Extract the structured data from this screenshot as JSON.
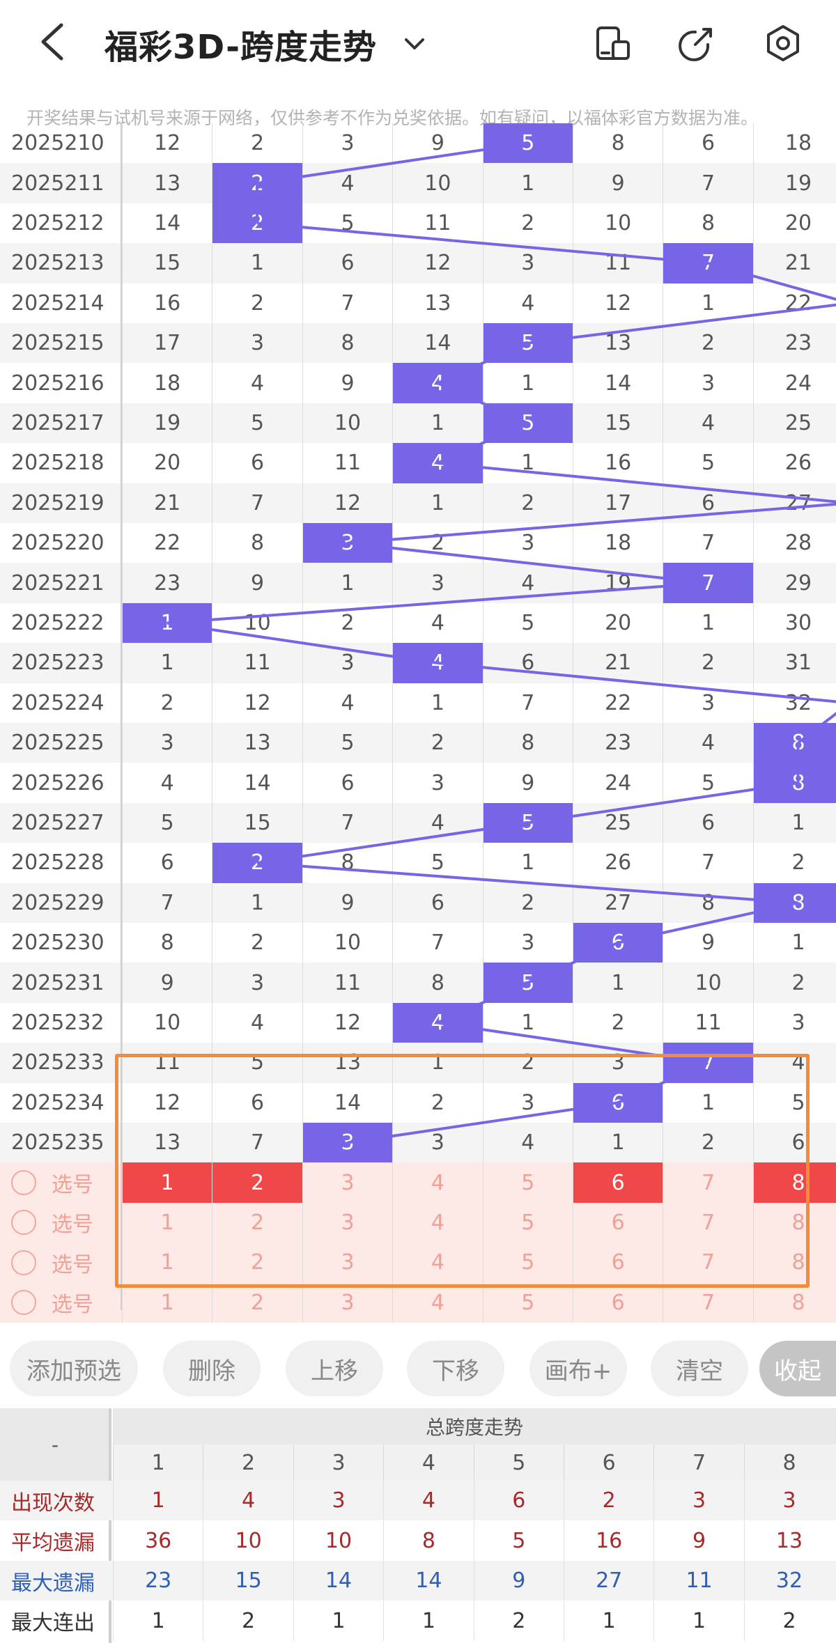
{
  "header": {
    "title": "福彩3D-跨度走势",
    "back_icon": "chevron-left-icon",
    "dropdown_icon": "chevron-down-icon",
    "icons": [
      "phone-layout-icon",
      "share-icon",
      "settings-icon"
    ]
  },
  "notice": "开奖结果与试机号来源于网络，仅供参考不作为兑奖依据。如有疑问，以福体彩官方数据为准。",
  "colors": {
    "hit": "#7665e6",
    "pick_selected": "#f04848",
    "pick_text": "#f0a097",
    "highlight_box": "#f28c3b",
    "stat_red": "#a52a2a",
    "stat_blue": "#2e5fb5"
  },
  "rows": [
    {
      "period": "2025210",
      "cells": [
        "12",
        "2",
        "3",
        "9",
        "5",
        "8",
        "6",
        "18"
      ],
      "hit": 4
    },
    {
      "period": "2025211",
      "cells": [
        "13",
        "2",
        "4",
        "10",
        "1",
        "9",
        "7",
        "19"
      ],
      "hit": 1
    },
    {
      "period": "2025212",
      "cells": [
        "14",
        "2",
        "5",
        "11",
        "2",
        "10",
        "8",
        "20"
      ],
      "hit": 1
    },
    {
      "period": "2025213",
      "cells": [
        "15",
        "1",
        "6",
        "12",
        "3",
        "11",
        "7",
        "21"
      ],
      "hit": 6
    },
    {
      "period": "2025214",
      "cells": [
        "16",
        "2",
        "7",
        "13",
        "4",
        "12",
        "1",
        "22"
      ],
      "hit": -1
    },
    {
      "period": "2025215",
      "cells": [
        "17",
        "3",
        "8",
        "14",
        "5",
        "13",
        "2",
        "23"
      ],
      "hit": 4
    },
    {
      "period": "2025216",
      "cells": [
        "18",
        "4",
        "9",
        "4",
        "1",
        "14",
        "3",
        "24"
      ],
      "hit": 3
    },
    {
      "period": "2025217",
      "cells": [
        "19",
        "5",
        "10",
        "1",
        "5",
        "15",
        "4",
        "25"
      ],
      "hit": 4
    },
    {
      "period": "2025218",
      "cells": [
        "20",
        "6",
        "11",
        "4",
        "1",
        "16",
        "5",
        "26"
      ],
      "hit": 3
    },
    {
      "period": "2025219",
      "cells": [
        "21",
        "7",
        "12",
        "1",
        "2",
        "17",
        "6",
        "27"
      ],
      "hit": -1
    },
    {
      "period": "2025220",
      "cells": [
        "22",
        "8",
        "3",
        "2",
        "3",
        "18",
        "7",
        "28"
      ],
      "hit": 2
    },
    {
      "period": "2025221",
      "cells": [
        "23",
        "9",
        "1",
        "3",
        "4",
        "19",
        "7",
        "29"
      ],
      "hit": 6
    },
    {
      "period": "2025222",
      "cells": [
        "1",
        "10",
        "2",
        "4",
        "5",
        "20",
        "1",
        "30"
      ],
      "hit": 0
    },
    {
      "period": "2025223",
      "cells": [
        "1",
        "11",
        "3",
        "4",
        "6",
        "21",
        "2",
        "31"
      ],
      "hit": 3
    },
    {
      "period": "2025224",
      "cells": [
        "2",
        "12",
        "4",
        "1",
        "7",
        "22",
        "3",
        "32"
      ],
      "hit": -1
    },
    {
      "period": "2025225",
      "cells": [
        "3",
        "13",
        "5",
        "2",
        "8",
        "23",
        "4",
        "8"
      ],
      "hit": 7
    },
    {
      "period": "2025226",
      "cells": [
        "4",
        "14",
        "6",
        "3",
        "9",
        "24",
        "5",
        "8"
      ],
      "hit": 7
    },
    {
      "period": "2025227",
      "cells": [
        "5",
        "15",
        "7",
        "4",
        "5",
        "25",
        "6",
        "1"
      ],
      "hit": 4
    },
    {
      "period": "2025228",
      "cells": [
        "6",
        "2",
        "8",
        "5",
        "1",
        "26",
        "7",
        "2"
      ],
      "hit": 1
    },
    {
      "period": "2025229",
      "cells": [
        "7",
        "1",
        "9",
        "6",
        "2",
        "27",
        "8",
        "8"
      ],
      "hit": 7
    },
    {
      "period": "2025230",
      "cells": [
        "8",
        "2",
        "10",
        "7",
        "3",
        "6",
        "9",
        "1"
      ],
      "hit": 5
    },
    {
      "period": "2025231",
      "cells": [
        "9",
        "3",
        "11",
        "8",
        "5",
        "1",
        "10",
        "2"
      ],
      "hit": 4
    },
    {
      "period": "2025232",
      "cells": [
        "10",
        "4",
        "12",
        "4",
        "1",
        "2",
        "11",
        "3"
      ],
      "hit": 3
    },
    {
      "period": "2025233",
      "cells": [
        "11",
        "5",
        "13",
        "1",
        "2",
        "3",
        "7",
        "4"
      ],
      "hit": 6
    },
    {
      "period": "2025234",
      "cells": [
        "12",
        "6",
        "14",
        "2",
        "3",
        "6",
        "1",
        "5"
      ],
      "hit": 5
    },
    {
      "period": "2025235",
      "cells": [
        "13",
        "7",
        "3",
        "3",
        "4",
        "1",
        "2",
        "6"
      ],
      "hit": 2
    }
  ],
  "pick_rows": [
    {
      "label": "选号",
      "cells": [
        "1",
        "2",
        "3",
        "4",
        "5",
        "6",
        "7",
        "8"
      ],
      "selected": [
        0,
        1,
        5,
        7
      ]
    },
    {
      "label": "选号",
      "cells": [
        "1",
        "2",
        "3",
        "4",
        "5",
        "6",
        "7",
        "8"
      ],
      "selected": []
    },
    {
      "label": "选号",
      "cells": [
        "1",
        "2",
        "3",
        "4",
        "5",
        "6",
        "7",
        "8"
      ],
      "selected": []
    },
    {
      "label": "选号",
      "cells": [
        "1",
        "2",
        "3",
        "4",
        "5",
        "6",
        "7",
        "8"
      ],
      "selected": []
    }
  ],
  "toolbar": {
    "add": "添加预选",
    "delete": "删除",
    "up": "上移",
    "down": "下移",
    "canvas": "画布+",
    "clear": "清空",
    "collapse": "收起"
  },
  "stats": {
    "corner": "-",
    "title": "总跨度走势",
    "columns": [
      "1",
      "2",
      "3",
      "4",
      "5",
      "6",
      "7",
      "8"
    ],
    "rows": [
      {
        "label": "出现次数",
        "color": "#a52a2a",
        "values": [
          "1",
          "4",
          "3",
          "4",
          "6",
          "2",
          "3",
          "3"
        ]
      },
      {
        "label": "平均遗漏",
        "color": "#a52a2a",
        "values": [
          "36",
          "10",
          "10",
          "8",
          "5",
          "16",
          "9",
          "13"
        ]
      },
      {
        "label": "最大遗漏",
        "color": "#2e5fb5",
        "values": [
          "23",
          "15",
          "14",
          "14",
          "9",
          "27",
          "11",
          "32"
        ]
      },
      {
        "label": "最大连出",
        "color": "#333333",
        "values": [
          "1",
          "2",
          "1",
          "1",
          "2",
          "1",
          "1",
          "2"
        ]
      }
    ]
  }
}
